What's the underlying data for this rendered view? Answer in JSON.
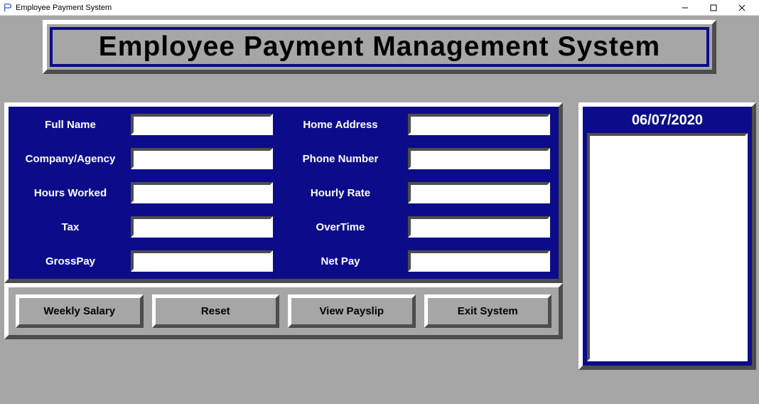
{
  "window": {
    "title": "Employee Payment System"
  },
  "header": {
    "title": "Employee Payment Management System"
  },
  "form": {
    "fullName_label": "Full Name",
    "fullName_value": "",
    "homeAddress_label": "Home Address",
    "homeAddress_value": "",
    "companyAgency_label": "Company/Agency",
    "companyAgency_value": "",
    "phoneNumber_label": "Phone Number",
    "phoneNumber_value": "",
    "hoursWorked_label": "Hours Worked",
    "hoursWorked_value": "",
    "hourlyRate_label": "Hourly Rate",
    "hourlyRate_value": "",
    "tax_label": "Tax",
    "tax_value": "",
    "overtime_label": "OverTime",
    "overtime_value": "",
    "grossPay_label": "GrossPay",
    "grossPay_value": "",
    "netPay_label": "Net Pay",
    "netPay_value": ""
  },
  "buttons": {
    "weeklySalary": "Weekly Salary",
    "reset": "Reset",
    "viewPayslip": "View Payslip",
    "exitSystem": "Exit System"
  },
  "sidebar": {
    "date": "06/07/2020"
  }
}
